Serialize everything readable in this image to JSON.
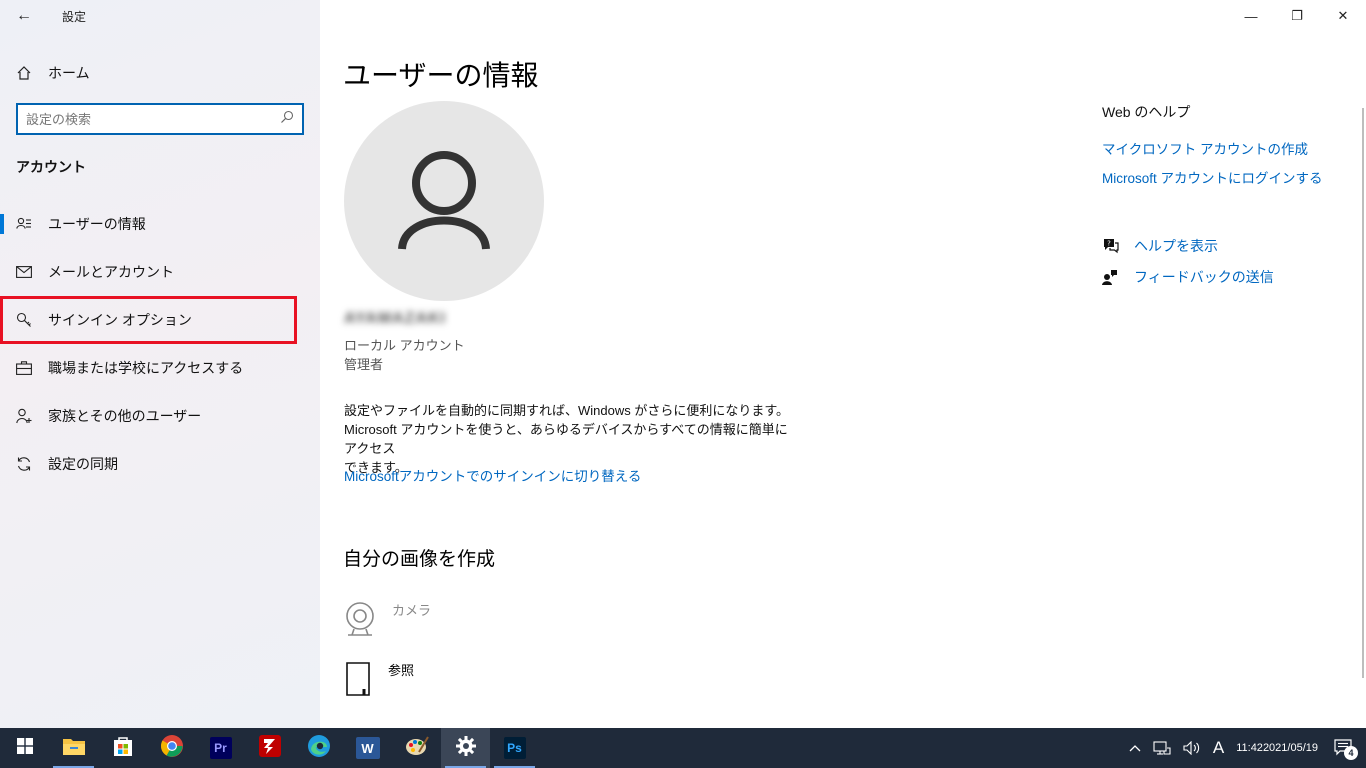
{
  "window": {
    "app_title": "設定",
    "controls": {
      "minimize": "—",
      "maximize": "❐",
      "close": "✕"
    }
  },
  "sidebar": {
    "home_label": "ホーム",
    "search_placeholder": "設定の検索",
    "section_title": "アカウント",
    "items": [
      {
        "label": "ユーザーの情報",
        "icon": "person-card-icon",
        "active": true
      },
      {
        "label": "メールとアカウント",
        "icon": "mail-icon",
        "active": false
      },
      {
        "label": "サインイン オプション",
        "icon": "key-icon",
        "active": false,
        "highlighted": true
      },
      {
        "label": "職場または学校にアクセスする",
        "icon": "briefcase-icon",
        "active": false
      },
      {
        "label": "家族とその他のユーザー",
        "icon": "person-add-icon",
        "active": false
      },
      {
        "label": "設定の同期",
        "icon": "sync-icon",
        "active": false
      }
    ]
  },
  "main": {
    "page_title": "ユーザーの情報",
    "user_name": "AYAMAZAKI",
    "account_type": "ローカル アカウント",
    "account_role": "管理者",
    "description_line1": "設定やファイルを自動的に同期すれば、Windows がさらに便利になります。",
    "description_line2": "Microsoft アカウントを使うと、あらゆるデバイスからすべての情報に簡単にアクセス",
    "description_line3": "できます。",
    "switch_link": "Microsoftアカウントでのサインインに切り替える",
    "picture_section": "自分の画像を作成",
    "camera_label": "カメラ",
    "browse_label": "参照"
  },
  "help": {
    "title": "Web のヘルプ",
    "links": [
      "マイクロソフト アカウントの作成",
      "Microsoft アカウントにログインする"
    ],
    "show_help": "ヘルプを表示",
    "send_feedback": "フィードバックの送信"
  },
  "taskbar": {
    "apps": [
      {
        "name": "start",
        "label": ""
      },
      {
        "name": "file-explorer",
        "label": ""
      },
      {
        "name": "store",
        "label": ""
      },
      {
        "name": "chrome",
        "label": ""
      },
      {
        "name": "premiere",
        "label": "Pr"
      },
      {
        "name": "filezilla",
        "label": ""
      },
      {
        "name": "edge",
        "label": ""
      },
      {
        "name": "word",
        "label": "W"
      },
      {
        "name": "paint",
        "label": ""
      },
      {
        "name": "settings",
        "label": ""
      },
      {
        "name": "photoshop",
        "label": "Ps"
      }
    ],
    "ime": "A",
    "time": "11:42",
    "date": "2021/05/19",
    "notification_count": "4"
  },
  "colors": {
    "accent": "#0078d7",
    "link": "#0067c0",
    "highlight_box": "#e81123",
    "taskbar": "#1f2a3a"
  }
}
